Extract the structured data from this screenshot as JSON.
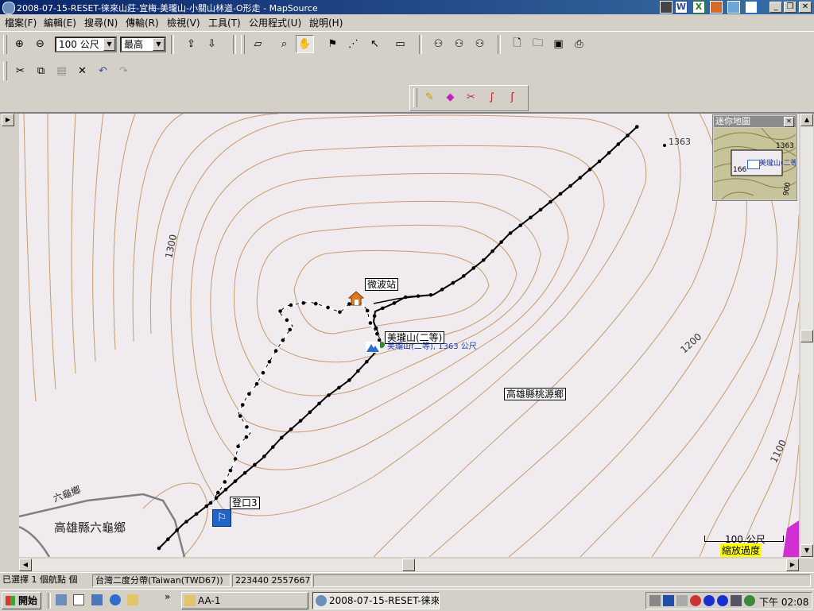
{
  "window": {
    "title": "2008-07-15-RESET-徕來山莊-宜梅-美瓏山-小關山林道-O形走 - MapSource"
  },
  "menu": [
    "檔案(F)",
    "編輯(E)",
    "搜尋(N)",
    "傳輸(R)",
    "檢視(V)",
    "工具(T)",
    "公用程式(U)",
    "說明(H)"
  ],
  "toolbar": {
    "scale_value": "100 公尺",
    "detail_value": "最高"
  },
  "map": {
    "contours": {
      "c1300": "1300",
      "c1200": "1200",
      "c1100": "1100"
    },
    "spot_height": "1363",
    "labels": {
      "relay": "微波站",
      "summit": "美瓏山(二等)",
      "summit_elev": "美瓏山(二等), 1363 公尺",
      "trailhead": "登口3",
      "district_taoyuan": "高雄縣桃源鄉",
      "district_liugui": "高雄縣六龜鄉",
      "liugui": "六龜鄉"
    },
    "scale_bar": "100 公尺",
    "overzoom": "縮放過度",
    "minimap": {
      "title": "迷你地圖",
      "spot": "1363",
      "left_num": "166",
      "contour": "900",
      "summit": "美瓏山(二等"
    }
  },
  "status": {
    "selection": "已選擇 1 個航點 個",
    "datum": "台灣二度分帶(Taiwan(TWD67))",
    "coords": "223440 2557667"
  },
  "taskbar": {
    "start": "開始",
    "chevron": "»",
    "task1": "AA-1",
    "task2": "2008-07-15-RESET-徕來...",
    "clock": "下午 02:08"
  },
  "colors": {
    "titlebar": "#0a246a",
    "contour": "#c99a6a",
    "track": "#000000",
    "map_bg": "#efebee",
    "admin_line": "#808080"
  }
}
